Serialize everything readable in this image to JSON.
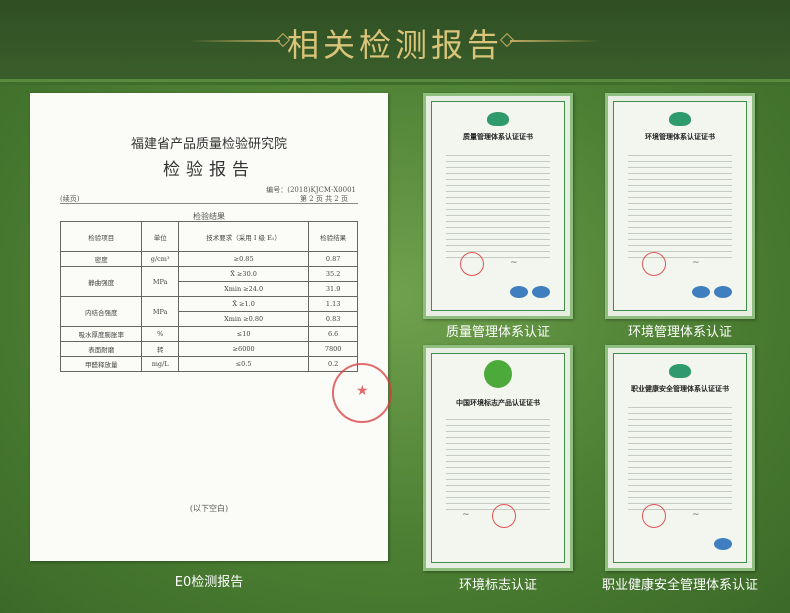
{
  "header": {
    "title": "相关检测报告"
  },
  "report": {
    "institute": "福建省产品质量检验研究院",
    "title": "检验报告",
    "number": "编号：(2018)KJCM-X0001",
    "page": "第 2 页  共 2 页",
    "tag": "(续页)",
    "results_title": "检验结果",
    "columns": [
      "检验项目",
      "单位",
      "技术要求（采用 I 级 E₁）",
      "检验结果"
    ],
    "rows": [
      {
        "item": "密度",
        "unit": "g/cm³",
        "req": "≥0.85",
        "result": "0.87"
      },
      {
        "item": "静曲强度",
        "unit": "MPa",
        "req": "X̄ ≥30.0",
        "result": "35.2"
      },
      {
        "item": "",
        "unit": "",
        "req": "Xmin ≥24.0",
        "result": "31.9"
      },
      {
        "item": "内结合强度",
        "unit": "MPa",
        "req": "X̄ ≥1.0",
        "result": "1.13"
      },
      {
        "item": "",
        "unit": "",
        "req": "Xmin ≥0.80",
        "result": "0.83"
      },
      {
        "item": "吸水厚度膨胀率",
        "unit": "%",
        "req": "≤10",
        "result": "6.6"
      },
      {
        "item": "表面耐磨",
        "unit": "转",
        "req": "≥6000",
        "result": "7800"
      },
      {
        "item": "甲醛释放量",
        "unit": "mg/L",
        "req": "≤0.5",
        "result": "0.2"
      }
    ],
    "blank_note": "(以下空白)",
    "caption": "E0检测报告"
  },
  "certificates": [
    {
      "title": "质量管理体系认证证书",
      "caption": "质量管理体系认证"
    },
    {
      "title": "环境管理体系认证证书",
      "caption": "环境管理体系认证"
    },
    {
      "title": "中国环境标志产品认证证书",
      "caption": "环境标志认证"
    },
    {
      "title": "职业健康安全管理体系认证证书",
      "caption": "职业健康安全管理体系认证"
    }
  ],
  "colors": {
    "background": "#4c7f33",
    "title_gold": "#d9c47a",
    "cert_border": "#8fbf80"
  }
}
